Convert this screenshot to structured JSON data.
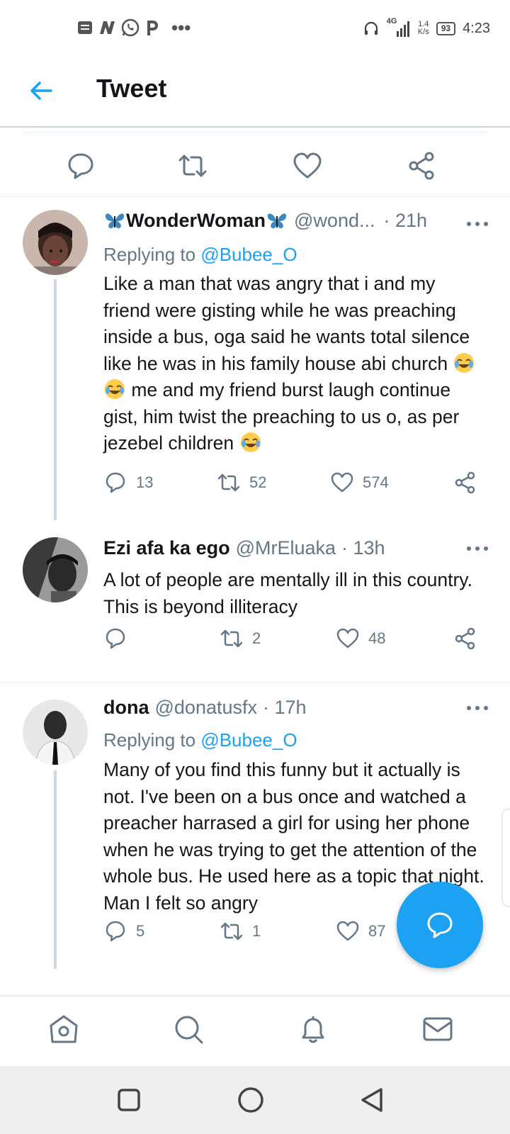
{
  "status_bar": {
    "left_icons": [
      "notification-icon",
      "n-icon",
      "whatsapp-icon",
      "p-icon"
    ],
    "more": "•••",
    "network": "4G",
    "speed_value": "1.4",
    "speed_unit": "K/s",
    "battery": "93",
    "time": "4:23"
  },
  "header": {
    "title": "Tweet"
  },
  "tweets": [
    {
      "name": "WonderWoman",
      "name_prefix_emoji": "butterfly",
      "name_suffix_emoji": "butterfly",
      "handle": "@wond...",
      "time": "· 21h",
      "replying_prefix": "Replying to ",
      "replying_to": "@Bubee_O",
      "text_1": "Like a man that was angry that i and my friend were gisting while he was preaching inside a bus, oga said he wants total silence like he was in his family house abi church ",
      "text_2": " me and my friend burst laugh continue gist, him twist the preaching to us o, as per jezebel children ",
      "replies": "13",
      "retweets": "52",
      "likes": "574"
    },
    {
      "name": "Ezi afa ka ego",
      "handle": "@MrEluaka",
      "time": "· 13h",
      "text": "A lot of people are mentally ill in this country. This is beyond illiteracy",
      "replies": "",
      "retweets": "2",
      "likes": "48"
    },
    {
      "name": "dona",
      "handle": "@donatusfx",
      "time": "· 17h",
      "replying_prefix": "Replying to ",
      "replying_to": "@Bubee_O",
      "text": "Many of you find this funny but it actually is not. I've been on a bus once and watched a preacher harrased a girl for using her phone when he was trying to get the attention of the whole bus. He used here as a topic that night. Man I felt so angry",
      "replies": "5",
      "retweets": "1",
      "likes": "87"
    }
  ],
  "colors": {
    "accent": "#1da1f2",
    "muted": "#657786",
    "text": "#14171a",
    "divider": "#e6ecf0"
  }
}
